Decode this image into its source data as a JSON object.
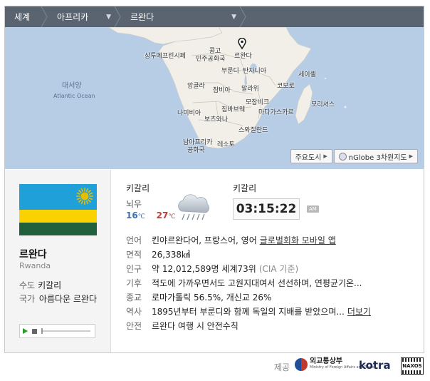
{
  "breadcrumb": {
    "items": [
      {
        "label": "세계"
      },
      {
        "label": "아프리카"
      },
      {
        "label": "르완다"
      }
    ]
  },
  "map": {
    "ocean_ko": "대서양",
    "ocean_en": "Atlantic Ocean",
    "labels": [
      "상투메프린시페",
      "콩고 민주공화국",
      "르완다",
      "부룬디",
      "탄자니아",
      "세이셸",
      "앙골라",
      "잠비아",
      "말라위",
      "코모로",
      "모잠비크",
      "짐바브웨",
      "마다가스카르",
      "모리셔스",
      "나미비아",
      "보츠와나",
      "스와질란드",
      "남아프리카 공화국",
      "레소토"
    ],
    "buttons": {
      "cities": "주요도시",
      "globe": "nGlobe 3차원지도"
    }
  },
  "country": {
    "name": "르완다",
    "name_en": "Rwanda",
    "capital_label": "수도",
    "capital": "키갈리",
    "anthem_label": "국가",
    "anthem": "아름다운 르완다"
  },
  "weather": {
    "city": "키갈리",
    "condition": "뇌우",
    "low": "16",
    "high": "27",
    "unit": "℃",
    "icon": "thunderstorm-cloud-icon"
  },
  "time": {
    "city": "키갈리",
    "clock": "03:15:22",
    "ampm": "AM"
  },
  "info": [
    {
      "key": "언어",
      "value": "킨야르완다어, 프랑스어, 영어",
      "link": "글로벌회화 모바일 앱"
    },
    {
      "key": "면적",
      "value": "26,338㎢"
    },
    {
      "key": "인구",
      "value": "약 12,012,589명 세계73위",
      "muted": "(CIA 기준)"
    },
    {
      "key": "기후",
      "value": "적도에 가까우면서도 고원지대여서 선선하며, 연평균기온..."
    },
    {
      "key": "종교",
      "value": "로마가톨릭 56.5%, 개신교 26%"
    },
    {
      "key": "역사",
      "value": "1895년부터 부룬디와 함께 독일의 지배를 받았으며...",
      "link": "더보기"
    },
    {
      "key": "안전",
      "value": "르완다 여행 시 안전수칙"
    }
  ],
  "footer": {
    "label": "제공",
    "mofa_ko": "외교통상부",
    "mofa_en": "Ministry of Foreign Affairs and Trade",
    "kotra": "kotra",
    "naxos": "NAXOS"
  },
  "colors": {
    "crumb_bg": "#5a6471",
    "ocean": "#b7cde5",
    "land": "#f1efe8",
    "flag_blue": "#20a0d8",
    "flag_yellow": "#fad201",
    "flag_green": "#20603d",
    "flag_sun": "#e5be01",
    "low_temp": "#3b6fb6",
    "high_temp": "#c23b3b"
  }
}
